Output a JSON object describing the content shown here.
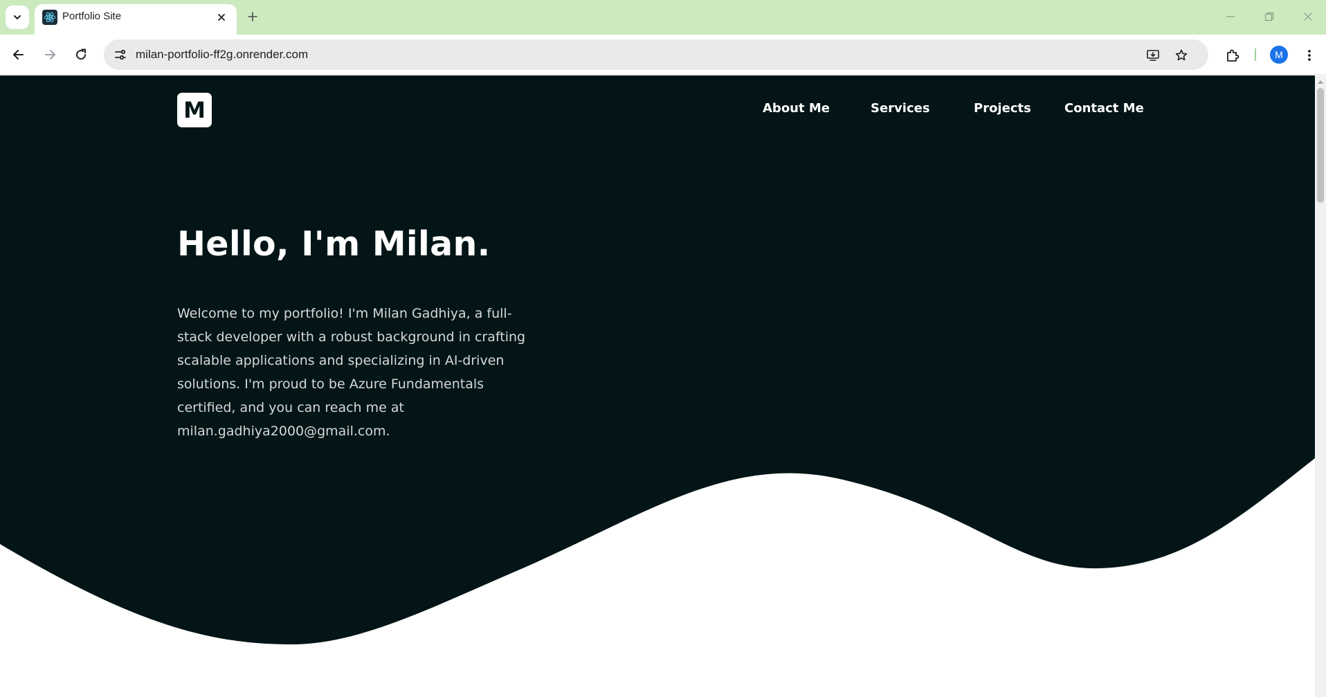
{
  "browser": {
    "tab": {
      "title": "Portfolio Site",
      "favicon": "react-atom-icon"
    },
    "url": "milan-portfolio-ff2g.onrender.com",
    "profile_initial": "M",
    "colors": {
      "tab_strip": "#cdeabf",
      "omnibox": "#e9ebe8",
      "avatar": "#1a73e8"
    }
  },
  "site": {
    "logo_letter": "M",
    "nav": {
      "about": "About Me",
      "services": "Services",
      "projects": "Projects",
      "contact": "Contact Me"
    },
    "hero": {
      "title": "Hello, I'm Milan.",
      "text": "Welcome to my portfolio! I'm Milan Gadhiya, a full-stack developer with a robust background in crafting scalable applications and specializing in AI-driven solutions. I'm proud to be Azure Fundamentals certified, and you can reach me at milan.gadhiya2000@gmail.com."
    },
    "colors": {
      "hero_background": "#041517",
      "page_background": "#ffffff",
      "hero_text": "#d5d9d9"
    }
  }
}
